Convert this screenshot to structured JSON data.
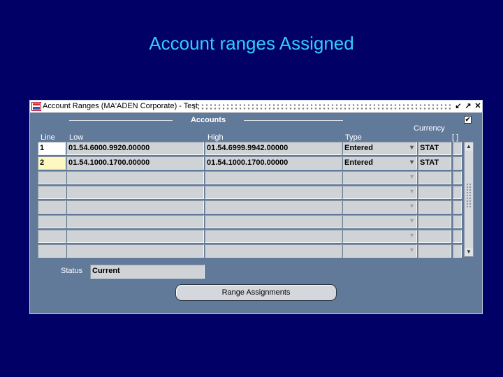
{
  "slide": {
    "title": "Account ranges Assigned"
  },
  "window": {
    "title": "Account Ranges (MA'ADEN Corporate) - Test",
    "buttons": {
      "minimize": "↙",
      "maximize": "↗",
      "close": "✕"
    }
  },
  "accounts": {
    "section_title": "Accounts",
    "columns": {
      "line": "Line",
      "low": "Low",
      "high": "High",
      "type": "Type",
      "currency": "Currency",
      "extra": "[ ]"
    },
    "checkbox_mark": "✔",
    "rows": [
      {
        "line": "1",
        "low": "01.54.6000.9920.00000",
        "high": "01.54.6999.9942.00000",
        "type": "Entered",
        "currency": "STAT"
      },
      {
        "line": "2",
        "low": "01.54.1000.1700.00000",
        "high": "01.54.1000.1700.00000",
        "type": "Entered",
        "currency": "STAT"
      },
      {
        "line": "",
        "low": "",
        "high": "",
        "type": "",
        "currency": ""
      },
      {
        "line": "",
        "low": "",
        "high": "",
        "type": "",
        "currency": ""
      },
      {
        "line": "",
        "low": "",
        "high": "",
        "type": "",
        "currency": ""
      },
      {
        "line": "",
        "low": "",
        "high": "",
        "type": "",
        "currency": ""
      },
      {
        "line": "",
        "low": "",
        "high": "",
        "type": "",
        "currency": ""
      },
      {
        "line": "",
        "low": "",
        "high": "",
        "type": "",
        "currency": ""
      }
    ]
  },
  "status": {
    "label": "Status",
    "value": "Current"
  },
  "range_button": {
    "label": "Range Assignments"
  },
  "colors": {
    "background": "#000066",
    "title": "#33ccff",
    "window": "#617a9a",
    "field": "#cfd3d6"
  }
}
